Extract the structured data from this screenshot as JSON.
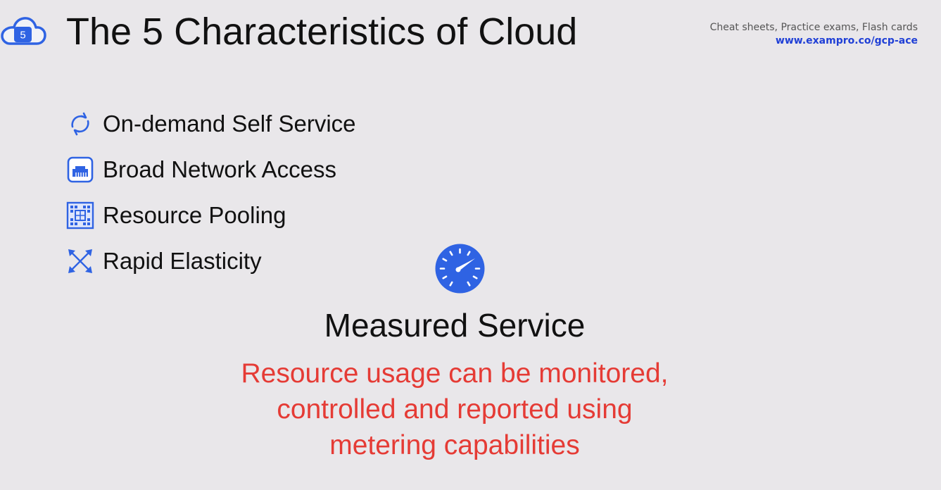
{
  "logo": {
    "badge": "5"
  },
  "title": "The 5 Characteristics of Cloud",
  "promo": {
    "line1": "Cheat sheets, Practice exams, Flash cards",
    "line2": "www.exampro.co/gcp-ace"
  },
  "items": [
    {
      "icon": "refresh-cycle-icon",
      "label": "On-demand Self Service"
    },
    {
      "icon": "network-port-icon",
      "label": "Broad Network Access"
    },
    {
      "icon": "resource-grid-icon",
      "label": "Resource Pooling"
    },
    {
      "icon": "expand-arrows-icon",
      "label": "Rapid Elasticity"
    }
  ],
  "highlight": {
    "icon": "speedometer-icon",
    "title": "Measured Service",
    "description": [
      "Resource usage can be monitored,",
      "controlled and reported using",
      "metering capabilities"
    ]
  },
  "colors": {
    "accent": "#2f63e3",
    "description": "#e53b35",
    "link": "#1f3fd6",
    "background": "#e9e7ea"
  }
}
